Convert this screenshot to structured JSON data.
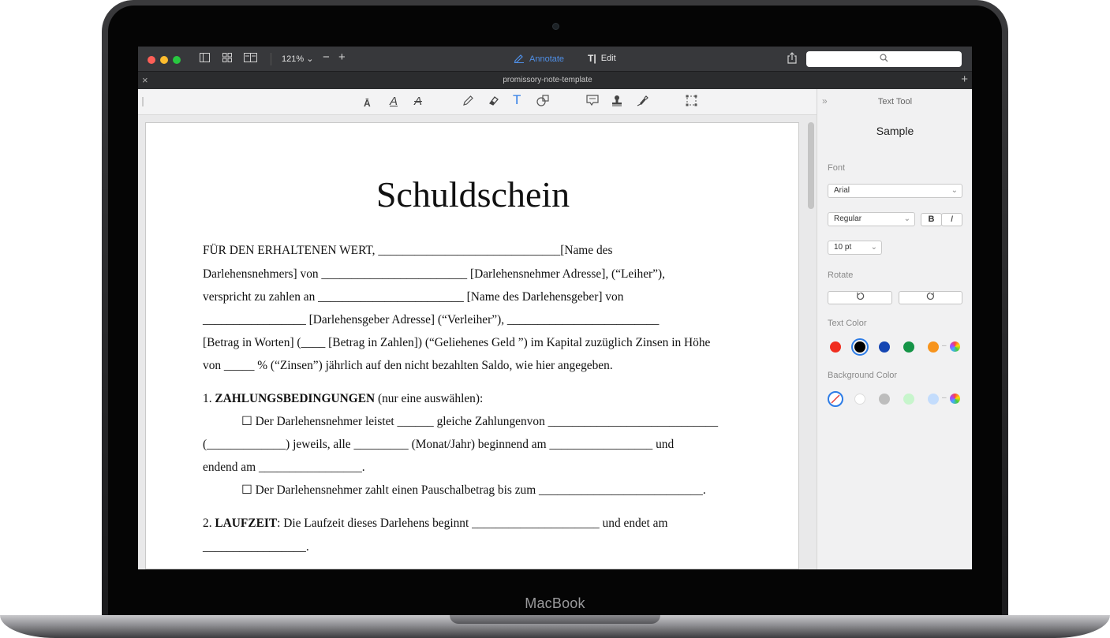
{
  "device": {
    "brand": "MacBook"
  },
  "titlebar": {
    "zoom": "121%",
    "annotate_label": "Annotate",
    "edit_label": "Edit",
    "search_placeholder": ""
  },
  "tab": {
    "title": "promissory-note-template"
  },
  "document": {
    "title": "Schuldschein",
    "lines": [
      "FÜR DEN ERHALTENEN WERT, ______________________________[Name des",
      "Darlehensnehmers] von ________________________ [Darlehensnehmer Adresse], (“Leiher”),",
      "verspricht zu zahlen an ________________________ [Name des Darlehensgeber] von",
      "_________________ [Darlehensgeber Adresse] (“Verleiher”), _________________________",
      "[Betrag in Worten] (____ [Betrag in Zahlen]) (“Geliehenes Geld ”) im Kapital zuzüglich Zinsen in Höhe",
      "von _____ % (“Zinsen”) jährlich auf den nicht bezahlten Saldo, wie hier angegeben."
    ],
    "section1_number": "1.",
    "section1_heading": "ZAHLUNGSBEDINGUNGEN",
    "section1_note": "(nur eine auswählen):",
    "opt1_line1": "☐ Der Darlehensnehmer leistet ______ gleiche Zahlungenvon ____________________________",
    "opt1_line2": "(_____________) jeweils, alle _________ (Monat/Jahr) beginnend am _________________ und",
    "opt1_line3": "endend am _________________.",
    "opt2_line1": "☐  Der Darlehensnehmer zahlt einen Pauschalbetrag bis zum ___________________________.",
    "section2_number": "2.",
    "section2_heading": "LAUFZEIT",
    "section2_text": ": Die Laufzeit dieses Darlehens beginnt _____________________ und endet am",
    "section2_line2": "_________________."
  },
  "panel": {
    "heading": "Text Tool",
    "sample": "Sample",
    "font_label": "Font",
    "font_value": "Arial",
    "style_value": "Regular",
    "bold_label": "B",
    "italic_label": "I",
    "size_value": "10 pt",
    "rotate_label": "Rotate",
    "text_color_label": "Text Color",
    "background_color_label": "Background Color",
    "text_colors": [
      "#f02d1f",
      "#000000",
      "#1546b3",
      "#159447",
      "#f7941d"
    ],
    "background_colors": [
      "#ffffff",
      "#bdbdbd",
      "#c7f5cc",
      "#c3dcfc"
    ]
  }
}
